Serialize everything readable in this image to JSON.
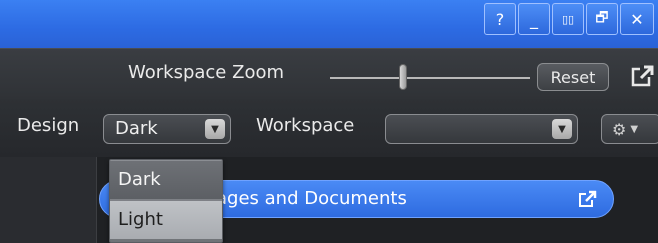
{
  "window_controls": {
    "help_label": "?",
    "minimize_label": "_",
    "split_label": "▯▯",
    "restore_label": "🗗",
    "close_label": "✕"
  },
  "zoom": {
    "label": "Workspace Zoom",
    "reset_label": "Reset"
  },
  "design": {
    "label": "Design",
    "selected": "Dark",
    "options": [
      "Dark",
      "Light"
    ]
  },
  "workspace": {
    "label": "Workspace",
    "selected": ""
  },
  "panel": {
    "images_bar_label": "ages and Documents"
  },
  "colors": {
    "titlebar": "#2d6be3",
    "accent_bar": "#3a7cf0",
    "toolbar_bg": "#2f3236"
  }
}
